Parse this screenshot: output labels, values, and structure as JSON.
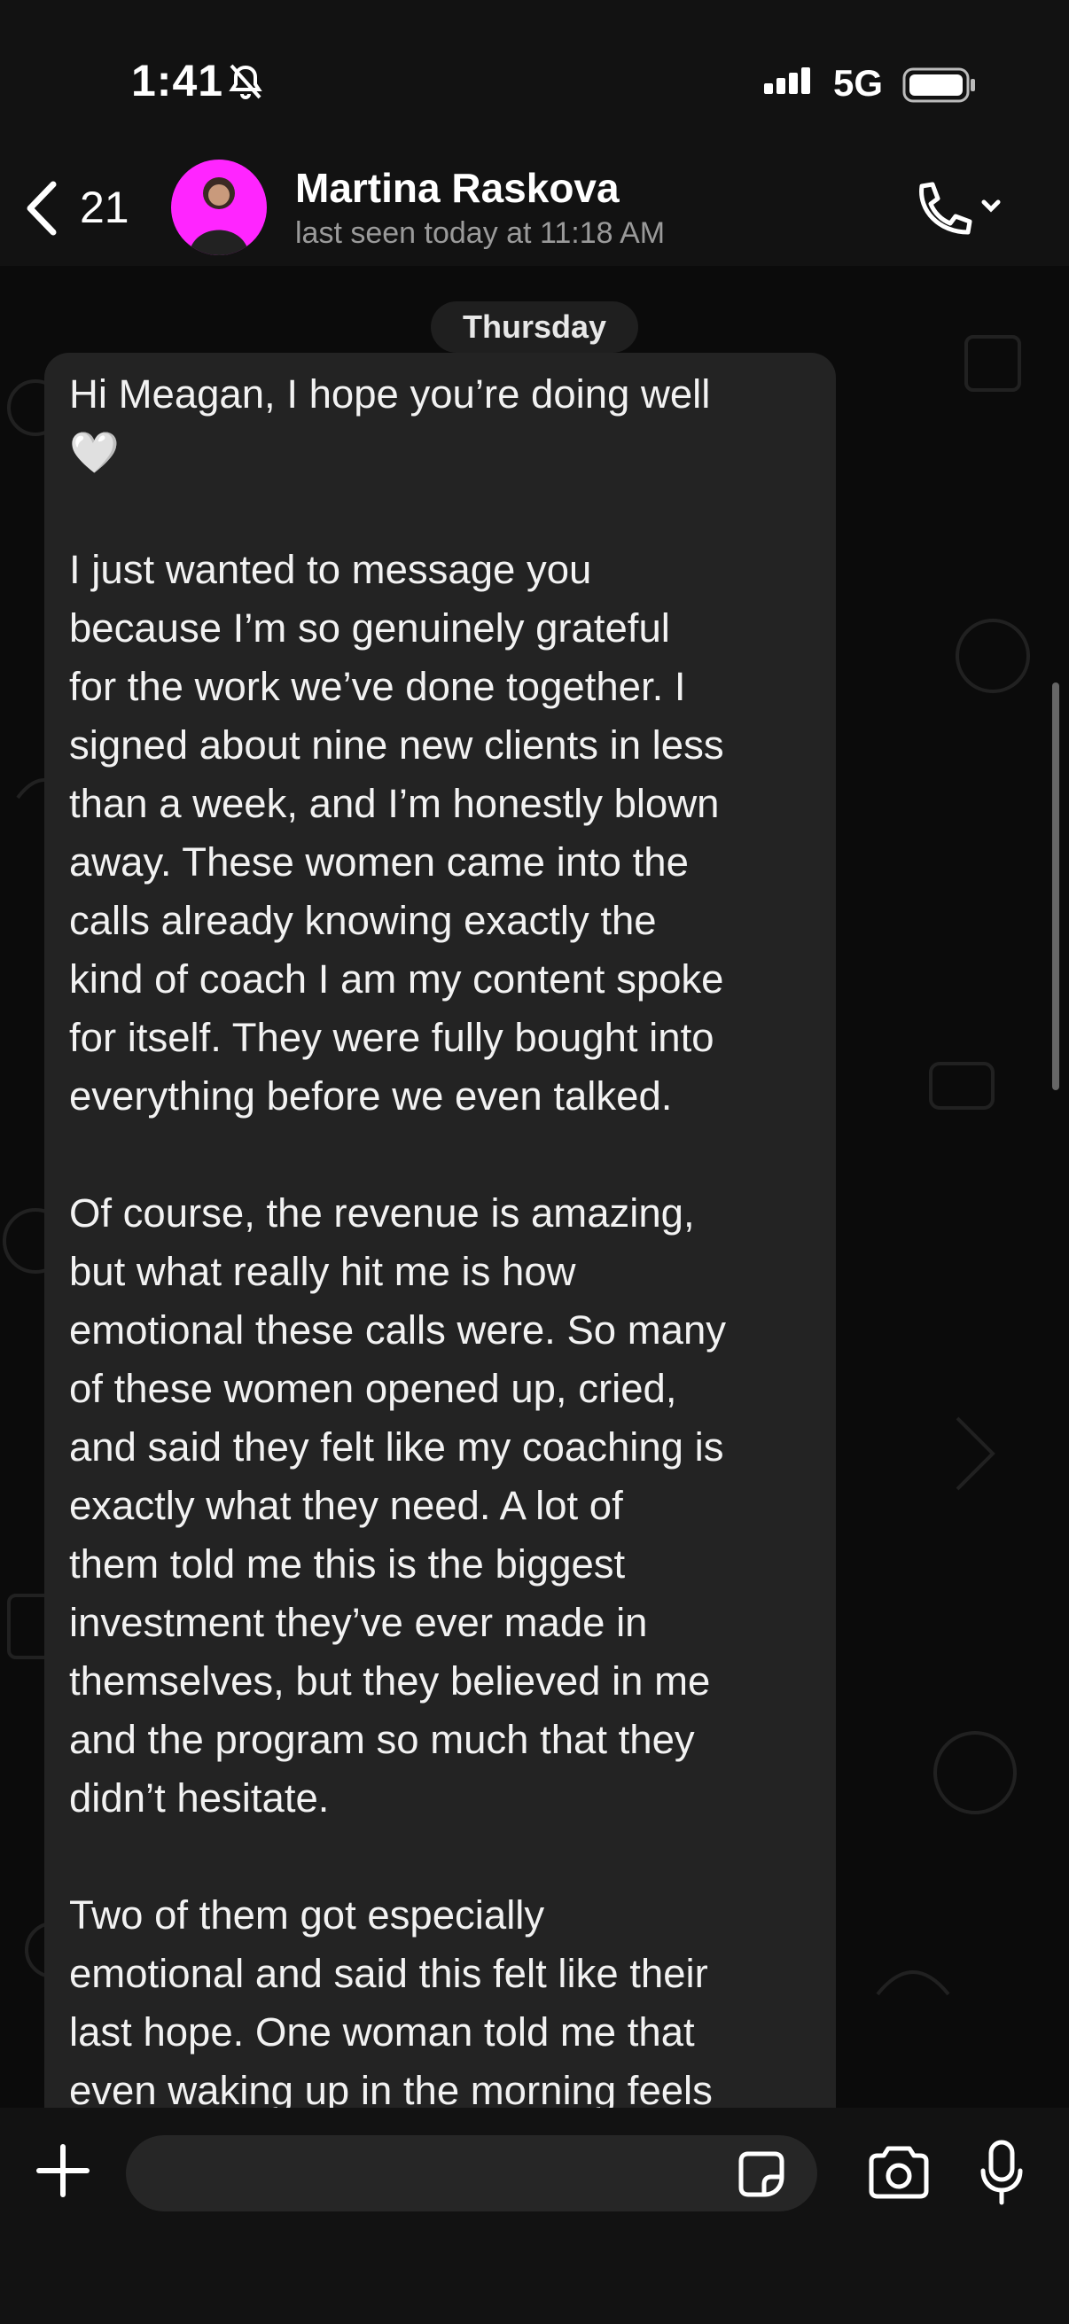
{
  "status_bar": {
    "time": "1:41",
    "network": "5G"
  },
  "header": {
    "back_count": "21",
    "contact_name": "Martina Raskova",
    "last_seen": "last seen today at 11:18 AM"
  },
  "chat": {
    "day_label": "Thursday",
    "message": "Hi Meagan, I hope you’re doing well\n🤍\n\nI just wanted to message you\nbecause I’m so genuinely grateful\nfor the work we’ve done together. I\nsigned about nine new clients in less\nthan a week, and I’m honestly blown\naway. These women came into the\ncalls already knowing exactly the\nkind of coach I am my content spoke\nfor itself. They were fully bought into\neverything before we even talked.\n\nOf course, the revenue is amazing,\nbut what really hit me is how\nemotional these calls were. So many\nof these women opened up, cried,\nand said they felt like my coaching is\nexactly what they need. A lot of\nthem told me this is the biggest\ninvestment they’ve ever made in\nthemselves, but they believed in me\nand the program so much that they\ndidn’t hesitate.\n\nTwo of them got especially\nemotional and said this felt like their\nlast hope. One woman told me that\neven waking up in the morning feels"
  },
  "composer": {
    "input_value": ""
  },
  "colors": {
    "background": "#0b0b0b",
    "bubble": "#232323",
    "accent_avatar": "#ff25ff"
  },
  "icons": [
    "bell-slash-icon",
    "signal-icon",
    "battery-icon",
    "back-chevron-icon",
    "phone-icon",
    "chevron-down-icon",
    "plus-icon",
    "sticker-icon",
    "camera-icon",
    "microphone-icon"
  ]
}
